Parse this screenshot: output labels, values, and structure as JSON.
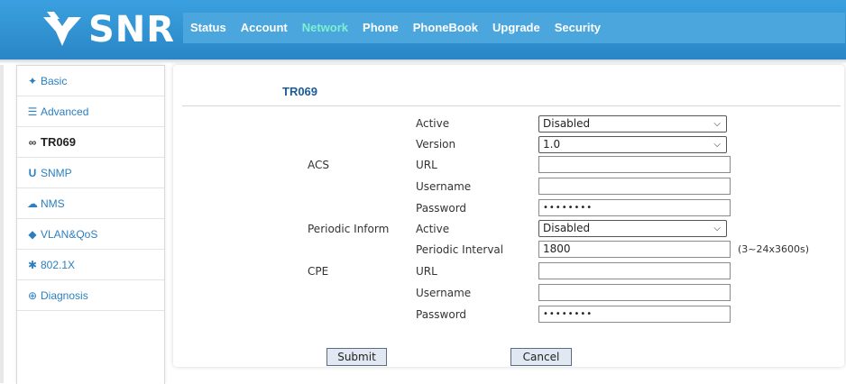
{
  "brand": {
    "name": "SNR",
    "color": "#ffffff"
  },
  "nav": [
    {
      "label": "Status",
      "active": false
    },
    {
      "label": "Account",
      "active": false
    },
    {
      "label": "Network",
      "active": true
    },
    {
      "label": "Phone",
      "active": false
    },
    {
      "label": "PhoneBook",
      "active": false
    },
    {
      "label": "Upgrade",
      "active": false
    },
    {
      "label": "Security",
      "active": false
    }
  ],
  "sidebar": [
    {
      "icon": "fire-icon",
      "glyph": "✦",
      "label": "Basic",
      "active": false
    },
    {
      "icon": "list-icon",
      "glyph": "☰",
      "label": "Advanced",
      "active": false
    },
    {
      "icon": "link-icon",
      "glyph": "∞",
      "label": "TR069",
      "active": true
    },
    {
      "icon": "magnet-icon",
      "glyph": "U",
      "label": "SNMP",
      "active": false
    },
    {
      "icon": "cloud-icon",
      "glyph": "☁",
      "label": "NMS",
      "active": false
    },
    {
      "icon": "pin-icon",
      "glyph": "◆",
      "label": "VLAN&QoS",
      "active": false
    },
    {
      "icon": "asterisk-icon",
      "glyph": "✱",
      "label": "802.1X",
      "active": false
    },
    {
      "icon": "zoom-icon",
      "glyph": "⊕",
      "label": "Diagnosis",
      "active": false
    }
  ],
  "page": {
    "title": "TR069"
  },
  "form": {
    "acs_group": "ACS",
    "periodic_group": "Periodic Inform",
    "cpe_group": "CPE",
    "acs_active_label": "Active",
    "acs_active_value": "Disabled",
    "acs_version_label": "Version",
    "acs_version_value": "1.0",
    "acs_url_label": "URL",
    "acs_url_value": "",
    "acs_username_label": "Username",
    "acs_username_value": "",
    "acs_password_label": "Password",
    "acs_password_value": "••••••••",
    "periodic_active_label": "Active",
    "periodic_active_value": "Disabled",
    "periodic_interval_label": "Periodic Interval",
    "periodic_interval_value": "1800",
    "periodic_interval_hint": "(3~24x3600s)",
    "cpe_url_label": "URL",
    "cpe_url_value": "",
    "cpe_username_label": "Username",
    "cpe_username_value": "",
    "cpe_password_label": "Password",
    "cpe_password_value": "••••••••"
  },
  "buttons": {
    "submit": "Submit",
    "cancel": "Cancel"
  },
  "colors": {
    "header": "#2f8fcf",
    "nav_active": "#7ef0d0",
    "title": "#1b5c9a",
    "side_link": "#2b7fc0"
  }
}
